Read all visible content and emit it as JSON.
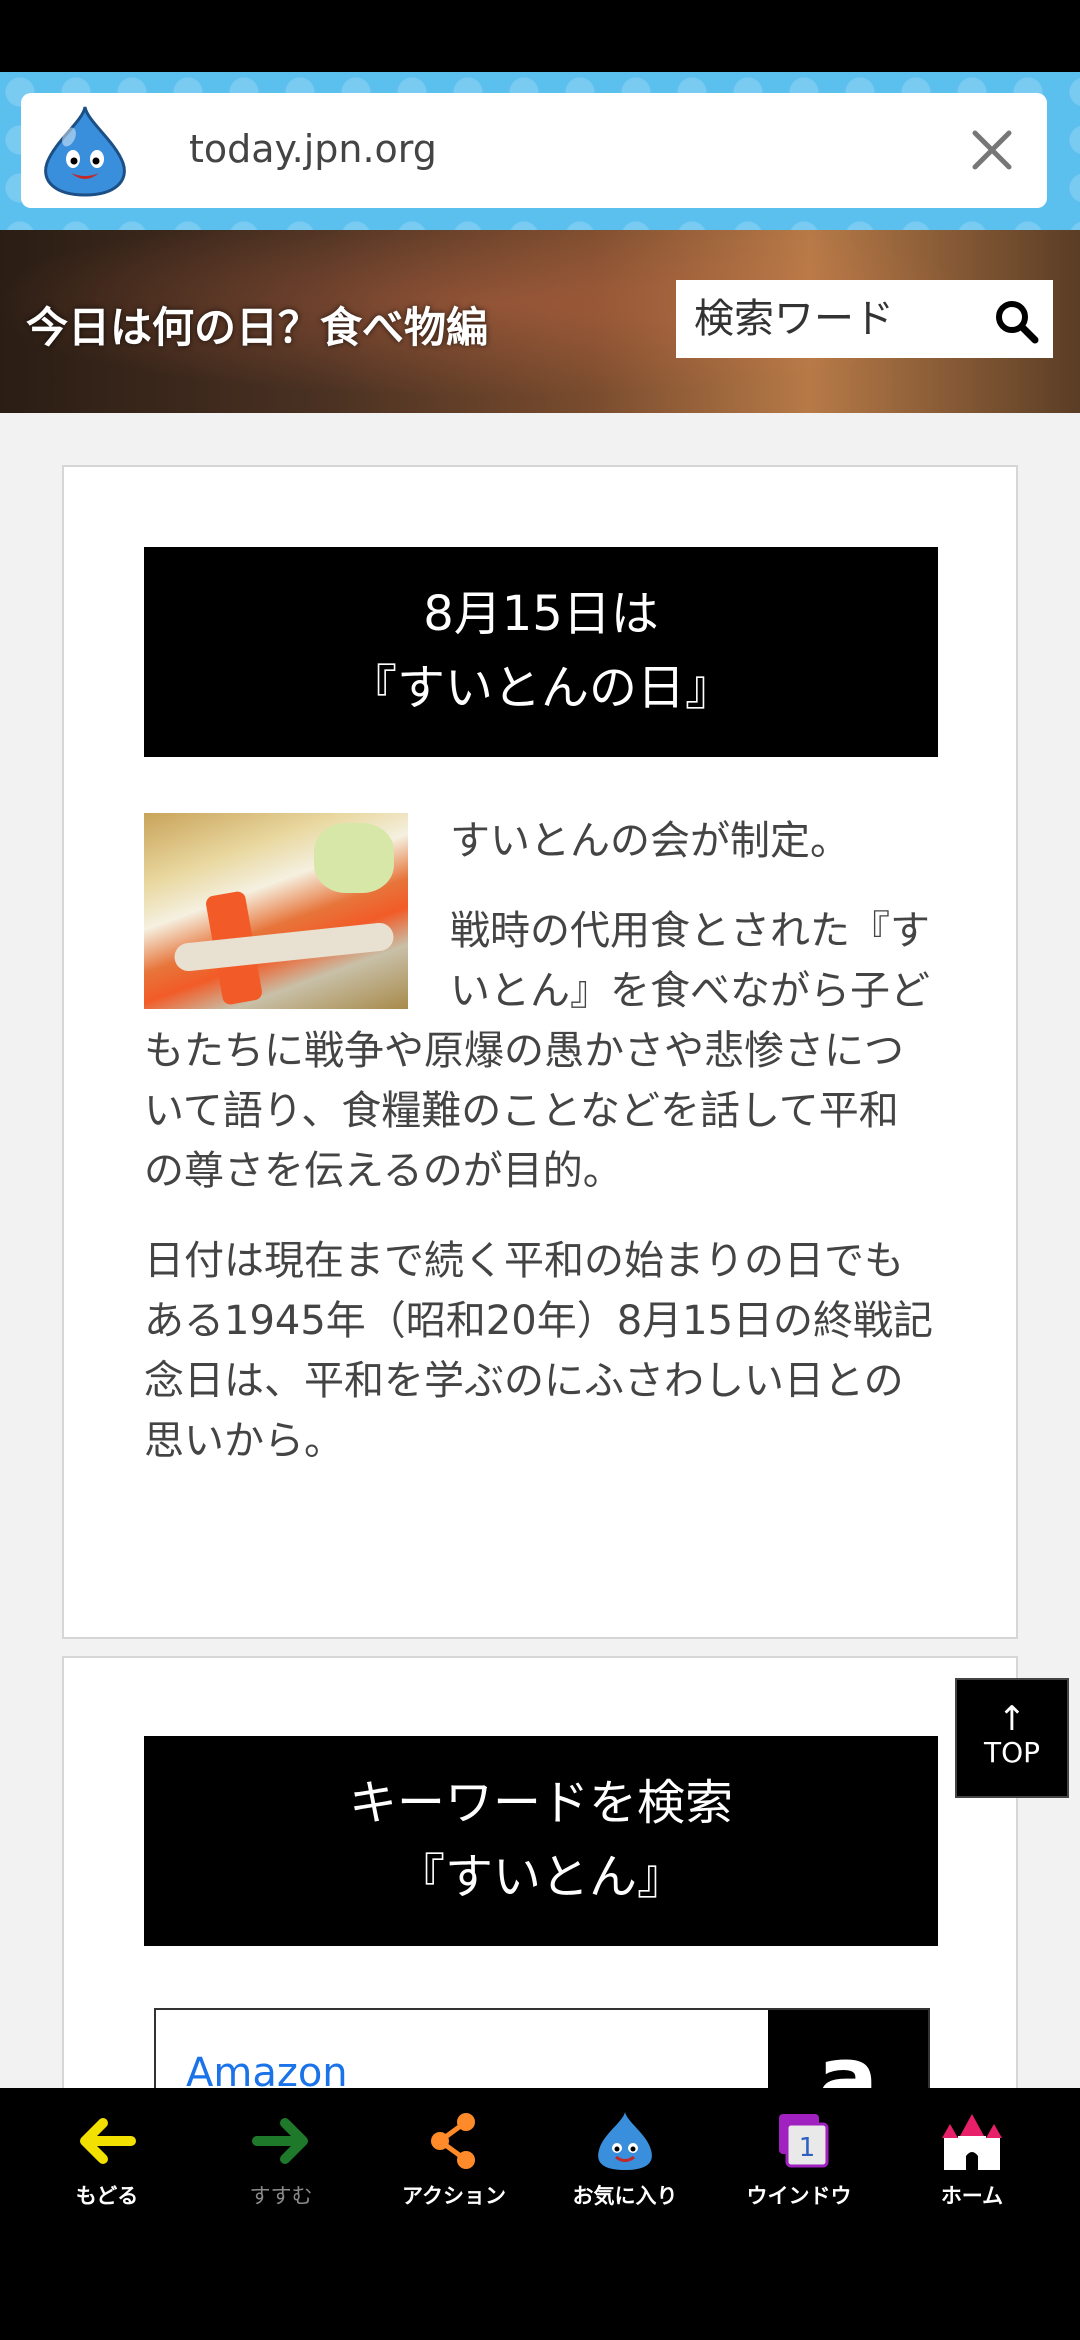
{
  "browser": {
    "url": "today.jpn.org"
  },
  "header": {
    "site_title": "今日は何の日？食べ物編",
    "search_placeholder": "検索ワード"
  },
  "article": {
    "title_line1": "8月15日は",
    "title_line2": "『すいとんの日』",
    "paragraph1": "すいとんの会が制定。",
    "paragraph2": "戦時の代用食とされた『すいとん』を食べながら子どもたちに戦争や原爆の愚かさや悲惨さについて語り、食糧難のことなどを話して平和の尊さを伝えるのが目的。",
    "paragraph3": "日付は現在まで続く平和の始まりの日でもある1945年（昭和20年）8月15日の終戦記念日は、平和を学ぶのにふさわしい日との思いから。"
  },
  "keyword_section": {
    "title_line1": "キーワードを検索",
    "title_line2": "『すいとん』",
    "amazon_label": "Amazon",
    "amazon_logo": "a"
  },
  "top_button": {
    "arrow": "↑",
    "label": "TOP"
  },
  "bottom_nav": {
    "back": "もどる",
    "forward": "すすむ",
    "action": "アクション",
    "favorites": "お気に入り",
    "window": "ウインドウ",
    "window_count": "1",
    "home": "ホーム"
  },
  "colors": {
    "url_bar_bg": "#5cc0ee",
    "back_arrow": "#f2e100",
    "forward_arrow": "#1e7a2a",
    "action_icon": "#ff8a2a",
    "slime": "#3a8fdc",
    "window_icon": "#a020c0",
    "home_icon": "#e8206a"
  }
}
